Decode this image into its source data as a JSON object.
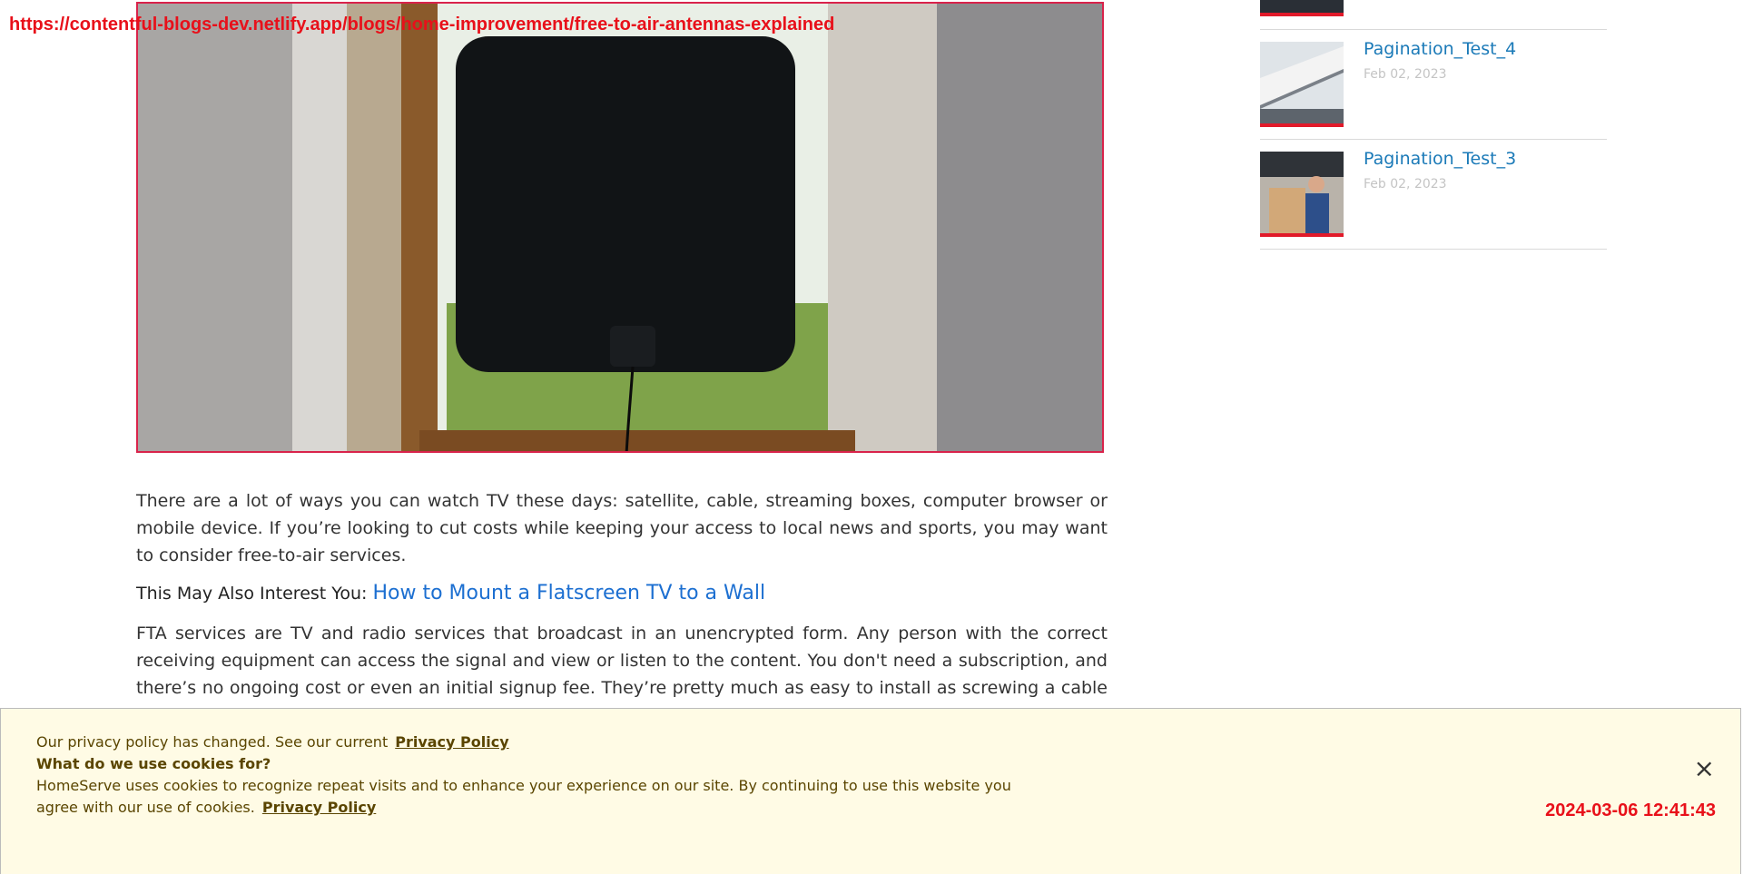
{
  "overlay": {
    "url": "https://contentful-blogs-dev.netlify.app/blogs/home-improvement/free-to-air-antennas-explained",
    "timestamp": "2024-03-06 12:41:43"
  },
  "article": {
    "paragraph1": "There are a lot of ways you can watch TV these days: satellite, cable, streaming boxes, computer browser or mobile device. If you’re looking to cut costs while keeping your access to local news and sports, you may want to consider free-to-air services.",
    "also_interest_lead": "This May Also Interest You:",
    "also_interest_link": "How to Mount a Flatscreen TV to a Wall",
    "paragraph2": "FTA services are TV and radio services that broadcast in an unencrypted form. Any person with the correct receiving equipment can access the signal and view or listen to the content. You don't need a subscription, and there’s no ongoing cost or even an initial signup fee. They’re pretty much as easy to install as screwing a cable into the back of your TV and"
  },
  "sidebar": {
    "items": [
      {
        "title": "Pagination_Test_4",
        "date": "Feb 02, 2023"
      },
      {
        "title": "Pagination_Test_3",
        "date": "Feb 02, 2023"
      }
    ]
  },
  "cookie": {
    "line1": "Our privacy policy has changed. See our current",
    "line1_link": "Privacy Policy",
    "line2": "What do we use cookies for?",
    "line3": "HomeServe uses cookies to recognize repeat visits and to enhance your experience on our site. By continuing to use this website you",
    "line4": "agree with our use of cookies.",
    "line4_link": "Privacy Policy",
    "close": "×"
  },
  "colors": {
    "accent_red": "#e11a2a",
    "link_blue": "#1c6fd1",
    "sidebar_title_blue": "#1b7ab8",
    "cookie_bg": "#fffbe5"
  }
}
